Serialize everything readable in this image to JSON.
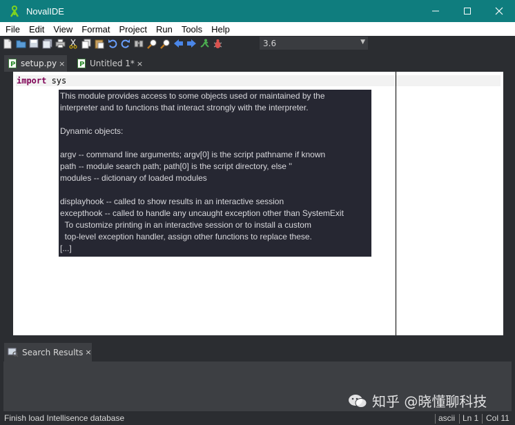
{
  "window": {
    "title": "NovalIDE"
  },
  "menu": [
    "File",
    "Edit",
    "View",
    "Format",
    "Project",
    "Run",
    "Tools",
    "Help"
  ],
  "toolbar": {
    "icons": [
      "new-file-icon",
      "open-file-icon",
      "save-icon",
      "save-all-icon",
      "print-icon",
      "cut-icon",
      "copy-icon",
      "paste-icon",
      "undo-icon",
      "redo-icon",
      "find-icon",
      "zoom-in-icon",
      "zoom-out-icon",
      "back-icon",
      "forward-icon",
      "run-icon",
      "debug-icon"
    ],
    "interpreter_version": "3.6"
  },
  "tabs": [
    {
      "label": "setup.py",
      "close": "×"
    },
    {
      "label": "Untitled 1*",
      "close": "×"
    }
  ],
  "editor": {
    "code": {
      "keyword": "import",
      "rest": " sys"
    },
    "calltip_lines": [
      "This module provides access to some objects used or maintained by the",
      "interpreter and to functions that interact strongly with the interpreter.",
      "",
      "Dynamic objects:",
      "",
      "argv -- command line arguments; argv[0] is the script pathname if known",
      "path -- module search path; path[0] is the script directory, else ''",
      "modules -- dictionary of loaded modules",
      "",
      "displayhook -- called to show results in an interactive session",
      "excepthook -- called to handle any uncaught exception other than SystemExit",
      "  To customize printing in an interactive session or to install a custom",
      "  top-level exception handler, assign other functions to replace these.",
      "[...]"
    ]
  },
  "bottom_panel": {
    "tab_label": "Search Results",
    "close": "×"
  },
  "status": {
    "message": "Finish load Intellisence database",
    "encoding": "ascii",
    "line": "Ln 1",
    "column": "Col 11"
  },
  "watermark": "知乎 @晓懂聊科技",
  "colors": {
    "titlebar": "#0f7d7e",
    "background": "#2b2d31",
    "calltip_bg": "#262732",
    "keyword": "#7f0055"
  }
}
